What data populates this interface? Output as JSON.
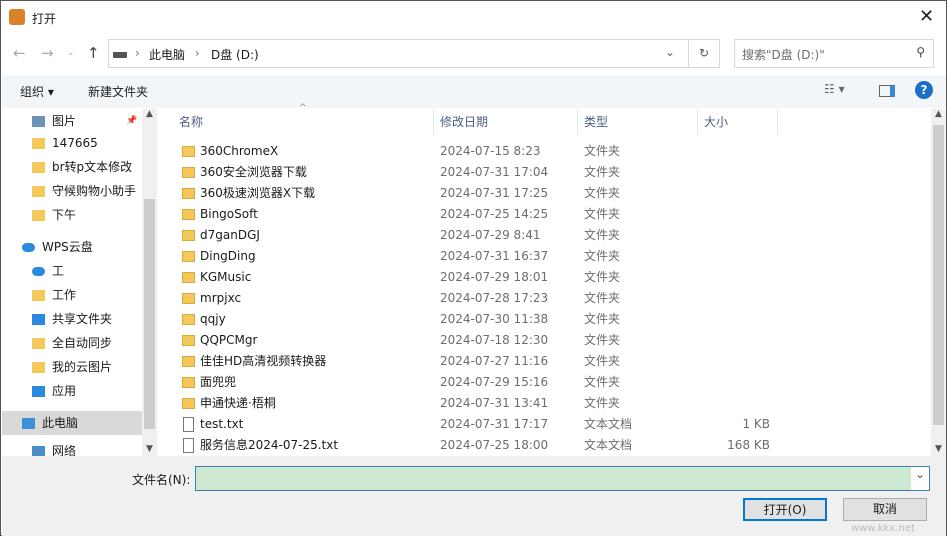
{
  "window": {
    "title": "打开"
  },
  "address": {
    "crumbs": [
      "此电脑",
      "D盘 (D:)"
    ],
    "search_placeholder": "搜索\"D盘 (D:)\""
  },
  "toolbar": {
    "organize": "组织 ▾",
    "new_folder": "新建文件夹"
  },
  "sidebar": {
    "items": [
      {
        "label": "图片",
        "icon": "pictures-icon"
      },
      {
        "label": "147665",
        "icon": "folder-icon"
      },
      {
        "label": "br转p文本修改",
        "icon": "folder-icon"
      },
      {
        "label": "守候购物小助手",
        "icon": "folder-icon"
      },
      {
        "label": "下午",
        "icon": "folder-icon"
      },
      {
        "label": "WPS云盘",
        "icon": "cloud-icon"
      },
      {
        "label": "工",
        "icon": "cloud-icon"
      },
      {
        "label": "工作",
        "icon": "folder-icon"
      },
      {
        "label": "共享文件夹",
        "icon": "share-icon"
      },
      {
        "label": "全自动同步",
        "icon": "folder-icon"
      },
      {
        "label": "我的云图片",
        "icon": "folder-icon"
      },
      {
        "label": "应用",
        "icon": "apps-icon"
      },
      {
        "label": "此电脑",
        "icon": "computer-icon"
      },
      {
        "label": "网络",
        "icon": "network-icon"
      }
    ]
  },
  "columns": {
    "name": "名称",
    "date": "修改日期",
    "type": "类型",
    "size": "大小"
  },
  "files": [
    {
      "name": "360ChromeX",
      "date": "2024-07-15 8:23",
      "type": "文件夹",
      "size": "",
      "kind": "folder"
    },
    {
      "name": "360安全浏览器下载",
      "date": "2024-07-31 17:04",
      "type": "文件夹",
      "size": "",
      "kind": "folder"
    },
    {
      "name": "360极速浏览器X下载",
      "date": "2024-07-31 17:25",
      "type": "文件夹",
      "size": "",
      "kind": "folder"
    },
    {
      "name": "BingoSoft",
      "date": "2024-07-25 14:25",
      "type": "文件夹",
      "size": "",
      "kind": "folder"
    },
    {
      "name": "d7ganDGJ",
      "date": "2024-07-29 8:41",
      "type": "文件夹",
      "size": "",
      "kind": "folder"
    },
    {
      "name": "DingDing",
      "date": "2024-07-31 16:37",
      "type": "文件夹",
      "size": "",
      "kind": "folder"
    },
    {
      "name": "KGMusic",
      "date": "2024-07-29 18:01",
      "type": "文件夹",
      "size": "",
      "kind": "folder"
    },
    {
      "name": "mrpjxc",
      "date": "2024-07-28 17:23",
      "type": "文件夹",
      "size": "",
      "kind": "folder"
    },
    {
      "name": "qqjy",
      "date": "2024-07-30 11:38",
      "type": "文件夹",
      "size": "",
      "kind": "folder"
    },
    {
      "name": "QQPCMgr",
      "date": "2024-07-18 12:30",
      "type": "文件夹",
      "size": "",
      "kind": "folder"
    },
    {
      "name": "佳佳HD高清视频转换器",
      "date": "2024-07-27 11:16",
      "type": "文件夹",
      "size": "",
      "kind": "folder"
    },
    {
      "name": "面兜兜",
      "date": "2024-07-29 15:16",
      "type": "文件夹",
      "size": "",
      "kind": "folder"
    },
    {
      "name": "申通快递·梧桐",
      "date": "2024-07-31 13:41",
      "type": "文件夹",
      "size": "",
      "kind": "folder"
    },
    {
      "name": "test.txt",
      "date": "2024-07-31 17:17",
      "type": "文本文档",
      "size": "1 KB",
      "kind": "file"
    },
    {
      "name": "服务信息2024-07-25.txt",
      "date": "2024-07-25 18:00",
      "type": "文本文档",
      "size": "168 KB",
      "kind": "file"
    }
  ],
  "footer": {
    "filename_label": "文件名(N):",
    "filename_value": "",
    "open": "打开(O)",
    "cancel": "取消"
  },
  "watermark": "www.kkx.net"
}
